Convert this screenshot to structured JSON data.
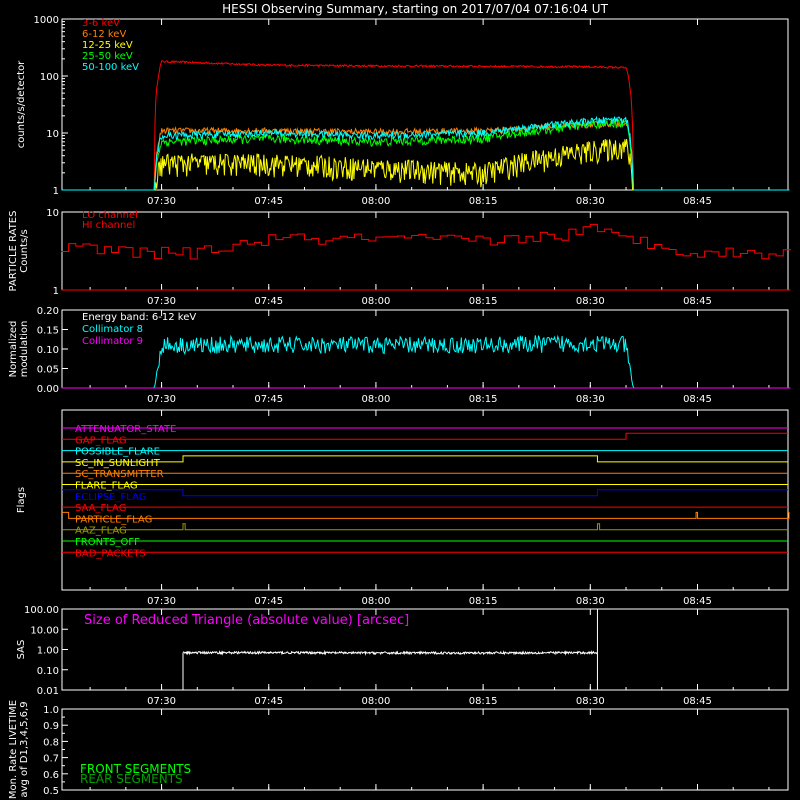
{
  "title": "HESSI Observing Summary, starting on 2017/07/04 07:16:04 UT",
  "time_ticks": [
    "07:30",
    "07:45",
    "08:00",
    "08:15",
    "08:30",
    "08:45"
  ],
  "colors": {
    "red": "#ff0000",
    "orange": "#ff7f00",
    "yellow": "#ffff00",
    "green": "#00ff00",
    "cyan": "#00ffff",
    "magenta": "#ff00ff",
    "blue": "#0000ff",
    "olive": "#999900",
    "white": "#ffffff",
    "axis": "#ffffff"
  },
  "chart_data": [
    {
      "type": "line",
      "id": "counts",
      "ylabel": "counts/s/detector",
      "yscale": "log",
      "ylim": [
        1,
        1000
      ],
      "yticks": [
        "1",
        "10",
        "100",
        "1000"
      ],
      "x_range": [
        "07:16",
        "08:58"
      ],
      "legend": [
        "3-6 keV",
        "6-12 keV",
        "12-25 keV",
        "25-50 keV",
        "50-100 keV"
      ],
      "series": [
        {
          "name": "3-6 keV",
          "color": "red",
          "x": [
            "07:16",
            "07:29",
            "07:30",
            "07:45",
            "08:00",
            "08:15",
            "08:30",
            "08:35",
            "08:36",
            "08:58"
          ],
          "values": [
            1,
            1,
            180,
            155,
            150,
            148,
            145,
            140,
            1,
            1
          ]
        },
        {
          "name": "6-12 keV",
          "color": "orange",
          "x": [
            "07:16",
            "07:29",
            "07:30",
            "07:45",
            "08:00",
            "08:15",
            "08:30",
            "08:35",
            "08:36",
            "08:58"
          ],
          "values": [
            1,
            1,
            11,
            11,
            10.5,
            11,
            14,
            15,
            1,
            1
          ]
        },
        {
          "name": "12-25 keV",
          "color": "yellow",
          "x": [
            "07:16",
            "07:29",
            "07:30",
            "07:45",
            "08:00",
            "08:15",
            "08:30",
            "08:35",
            "08:36",
            "08:58"
          ],
          "values": [
            1,
            1,
            3,
            3,
            2.5,
            2,
            5,
            6,
            1,
            1
          ]
        },
        {
          "name": "25-50 keV",
          "color": "green",
          "x": [
            "07:16",
            "07:29",
            "07:30",
            "07:45",
            "08:00",
            "08:15",
            "08:30",
            "08:35",
            "08:36",
            "08:58"
          ],
          "values": [
            1,
            1,
            7,
            8,
            7,
            8,
            14,
            15,
            1,
            1
          ]
        },
        {
          "name": "50-100 keV",
          "color": "cyan",
          "x": [
            "07:16",
            "07:29",
            "07:30",
            "07:45",
            "08:00",
            "08:15",
            "08:30",
            "08:35",
            "08:36",
            "08:58"
          ],
          "values": [
            1,
            1,
            9,
            10,
            9,
            10,
            16,
            18,
            1,
            1
          ]
        }
      ]
    },
    {
      "type": "line",
      "id": "particle",
      "ylabel": "PARTICLE RATES",
      "ylabel2": "Counts/s",
      "yscale": "log",
      "ylim": [
        1,
        10
      ],
      "yticks": [
        "1",
        "10"
      ],
      "legend": [
        "LO channel",
        "HI channel"
      ],
      "series": [
        {
          "name": "HI channel",
          "color": "red",
          "x": [
            "07:16",
            "07:28",
            "07:35",
            "07:45",
            "08:00",
            "08:15",
            "08:25",
            "08:30",
            "08:33",
            "08:38",
            "08:45",
            "08:58"
          ],
          "values": [
            3.5,
            3,
            3,
            4.5,
            4.5,
            4.3,
            5,
            6,
            5,
            4,
            3,
            3
          ]
        },
        {
          "name": "LO channel",
          "color": "red",
          "x": [
            "07:16",
            "08:58"
          ],
          "values": [
            1,
            1
          ]
        }
      ]
    },
    {
      "type": "line",
      "id": "modulation",
      "ylabel": "Normalized",
      "ylabel2": "modulation",
      "ylim": [
        0,
        0.2
      ],
      "yticks": [
        "0.00",
        "0.05",
        "0.10",
        "0.15",
        "0.20"
      ],
      "legend": [
        "Energy band: 6-12 keV",
        "Collimator 8",
        "Collimator 9"
      ],
      "series": [
        {
          "name": "Collimator 8",
          "color": "cyan",
          "x": [
            "07:16",
            "07:29",
            "07:30",
            "07:45",
            "08:00",
            "08:15",
            "08:30",
            "08:35",
            "08:36",
            "08:58"
          ],
          "values": [
            0,
            0,
            0.11,
            0.11,
            0.11,
            0.11,
            0.115,
            0.11,
            0,
            0
          ]
        },
        {
          "name": "Collimator 9",
          "color": "magenta",
          "x": [
            "07:16",
            "08:58"
          ],
          "values": [
            0,
            0
          ]
        }
      ]
    },
    {
      "type": "line",
      "id": "flags",
      "ylabel": "Flags",
      "flags": [
        {
          "name": "ATTENUATOR_STATE",
          "color": "magenta",
          "steps": [
            [
              "07:16",
              0
            ]
          ]
        },
        {
          "name": "GAP_FLAG",
          "color": "red",
          "steps": [
            [
              "07:16",
              0
            ],
            [
              "08:35",
              1
            ]
          ]
        },
        {
          "name": "POSSIBLE_FLARE",
          "color": "cyan",
          "steps": [
            [
              "07:16",
              0
            ]
          ]
        },
        {
          "name": "SC_IN_SUNLIGHT",
          "color": "yellow",
          "steps": [
            [
              "07:16",
              0
            ],
            [
              "07:33",
              1
            ],
            [
              "08:31",
              0
            ]
          ]
        },
        {
          "name": "SC_TRANSMITTER",
          "color": "orange",
          "steps": [
            [
              "07:16",
              0
            ]
          ]
        },
        {
          "name": "FLARE_FLAG",
          "color": "yellow",
          "steps": [
            [
              "07:16",
              0
            ]
          ]
        },
        {
          "name": "ECLIPSE_FLAG",
          "color": "blue",
          "steps": [
            [
              "07:16",
              1
            ],
            [
              "07:33",
              0
            ],
            [
              "08:31",
              1
            ]
          ]
        },
        {
          "name": "SAA_FLAG",
          "color": "red",
          "steps": [
            [
              "07:16",
              0
            ]
          ]
        },
        {
          "name": "PARTICLE_FLAG",
          "color": "orange",
          "steps": [
            [
              "07:16",
              1
            ],
            [
              "07:17",
              0
            ],
            [
              "08:44.8",
              1
            ],
            [
              "08:45",
              0
            ],
            [
              "08:57.8",
              1
            ]
          ]
        },
        {
          "name": "AAZ_FLAG",
          "color": "olive",
          "steps": [
            [
              "07:16",
              0
            ],
            [
              "07:33",
              1
            ],
            [
              "07:33.3",
              0
            ],
            [
              "08:31",
              1
            ],
            [
              "08:31.3",
              0
            ]
          ]
        },
        {
          "name": "FRONTS_OFF",
          "color": "green",
          "steps": [
            [
              "07:16",
              0
            ]
          ]
        },
        {
          "name": "BAD_PACKETS",
          "color": "red",
          "steps": [
            [
              "07:16",
              0
            ]
          ]
        }
      ]
    },
    {
      "type": "line",
      "id": "sas",
      "ylabel": "SAS",
      "yscale": "log",
      "ylim": [
        0.01,
        100
      ],
      "yticks": [
        "100.00",
        "10.00",
        "1.00",
        "0.10",
        "0.01"
      ],
      "annotation": "Size of Reduced Triangle (absolute value) [arcsec]",
      "series": [
        {
          "name": "",
          "color": "white",
          "x": [
            "07:33",
            "07:45",
            "08:00",
            "08:15",
            "08:30",
            "08:31"
          ],
          "values": [
            0.7,
            0.7,
            0.68,
            0.68,
            0.7,
            0.7
          ]
        }
      ]
    },
    {
      "type": "line",
      "id": "livetime",
      "ylabel": "Mon. Rate LIVETIME",
      "ylabel2": "avg of D1,3,4,5,6,9",
      "ylim": [
        0.5,
        1.0
      ],
      "yticks": [
        "0.5",
        "0.6",
        "0.7",
        "0.8",
        "0.9",
        "1.0"
      ],
      "legend": [
        "FRONT SEGMENTS",
        "REAR SEGMENTS"
      ],
      "series": []
    }
  ]
}
